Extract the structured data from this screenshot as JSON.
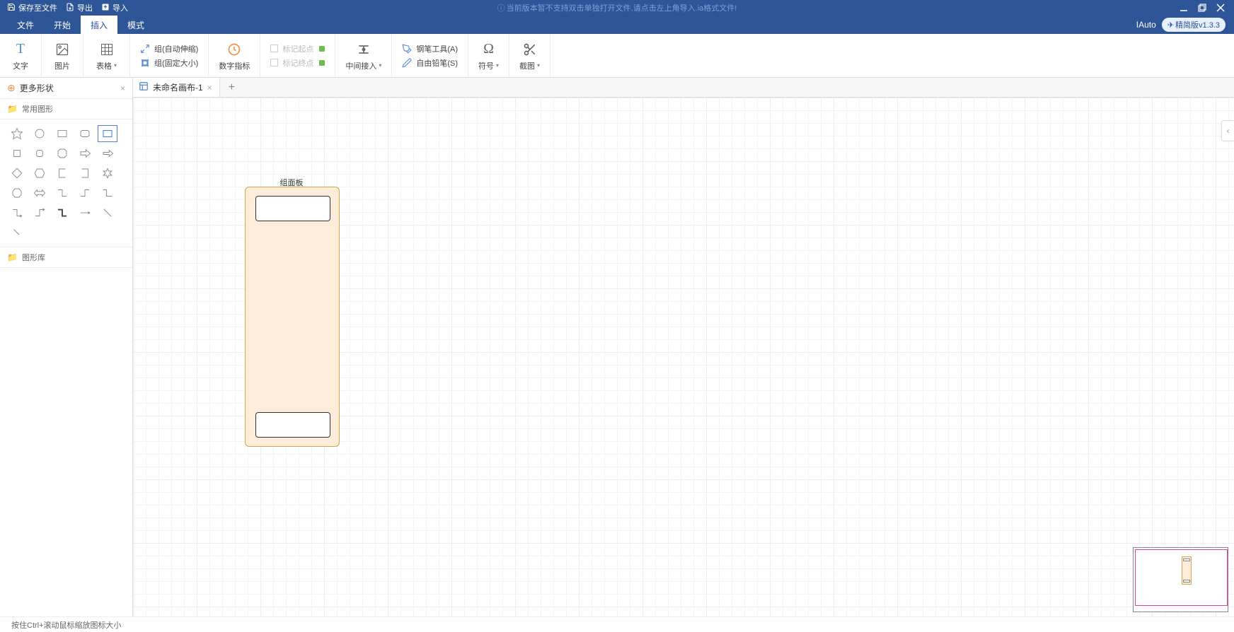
{
  "title_bar": {
    "save": "保存至文件",
    "export": "导出",
    "import": "导入",
    "warning": "当前版本暂不支持双击单独打开文件,请点击左上角导入.ia格式文件!"
  },
  "menu": {
    "tabs": [
      "文件",
      "开始",
      "插入",
      "模式"
    ],
    "active_index": 2,
    "brand": "IAuto",
    "version_label": "精简版v1.3.3"
  },
  "ribbon": {
    "text_label": "文字",
    "image_label": "图片",
    "table_label": "表格",
    "group_auto": "组(自动伸缩)",
    "group_fixed": "组(固定大小)",
    "digit_indicator": "数字指标",
    "mark_start": "标记起点",
    "mark_end": "标记终点",
    "mid_insert": "中间接入",
    "pen_tool": "钢笔工具(A)",
    "free_pencil": "自由铅笔(S)",
    "symbol": "符号",
    "crop": "截图"
  },
  "left_panel": {
    "more_shapes": "更多形状",
    "common_shapes": "常用图形",
    "shape_library": "图形库"
  },
  "tabs": {
    "doc1": "未命名画布-1"
  },
  "canvas": {
    "group_panel_title": "组面板"
  },
  "status_bar": {
    "hint": "按住Ctrl+滚动鼠标缩放图标大小"
  }
}
